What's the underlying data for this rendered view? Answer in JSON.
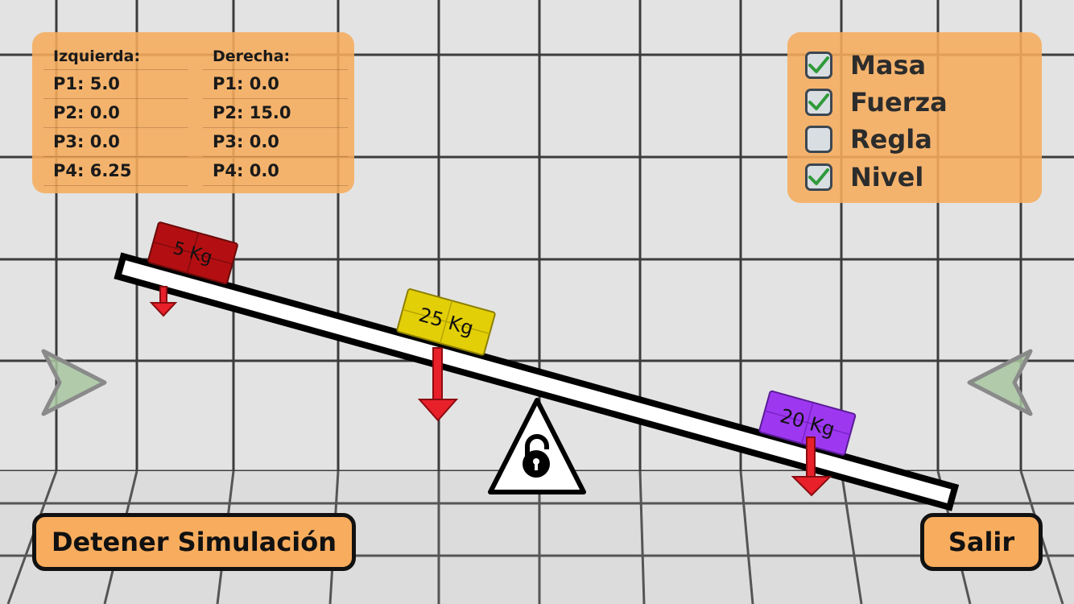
{
  "readout": {
    "left": {
      "header": "Izquierda:",
      "rows": [
        "P1: 5.0",
        "P2: 0.0",
        "P3: 0.0",
        "P4: 6.25"
      ]
    },
    "right": {
      "header": "Derecha:",
      "rows": [
        "P1: 0.0",
        "P2: 15.0",
        "P3: 0.0",
        "P4: 0.0"
      ]
    }
  },
  "options": [
    {
      "label": "Masa",
      "checked": true
    },
    {
      "label": "Fuerza",
      "checked": true
    },
    {
      "label": "Regla",
      "checked": false
    },
    {
      "label": "Nivel",
      "checked": true
    }
  ],
  "weights": [
    {
      "label": "5 Kg",
      "color": "#b30f12"
    },
    {
      "label": "25 Kg",
      "color": "#e3cf08"
    },
    {
      "label": "20 Kg",
      "color": "#9d38f0"
    }
  ],
  "buttons": {
    "stop": "Detener Simulación",
    "exit": "Salir"
  },
  "icons": {
    "fulcrum": "unlocked-padlock-icon",
    "nav_left": "arrow-right-icon",
    "nav_right": "arrow-left-icon"
  },
  "colors": {
    "panel": "#f6ac5c",
    "button": "#f7ac5e",
    "force_arrow": "#e8202a",
    "check": "#2f9a3a"
  }
}
